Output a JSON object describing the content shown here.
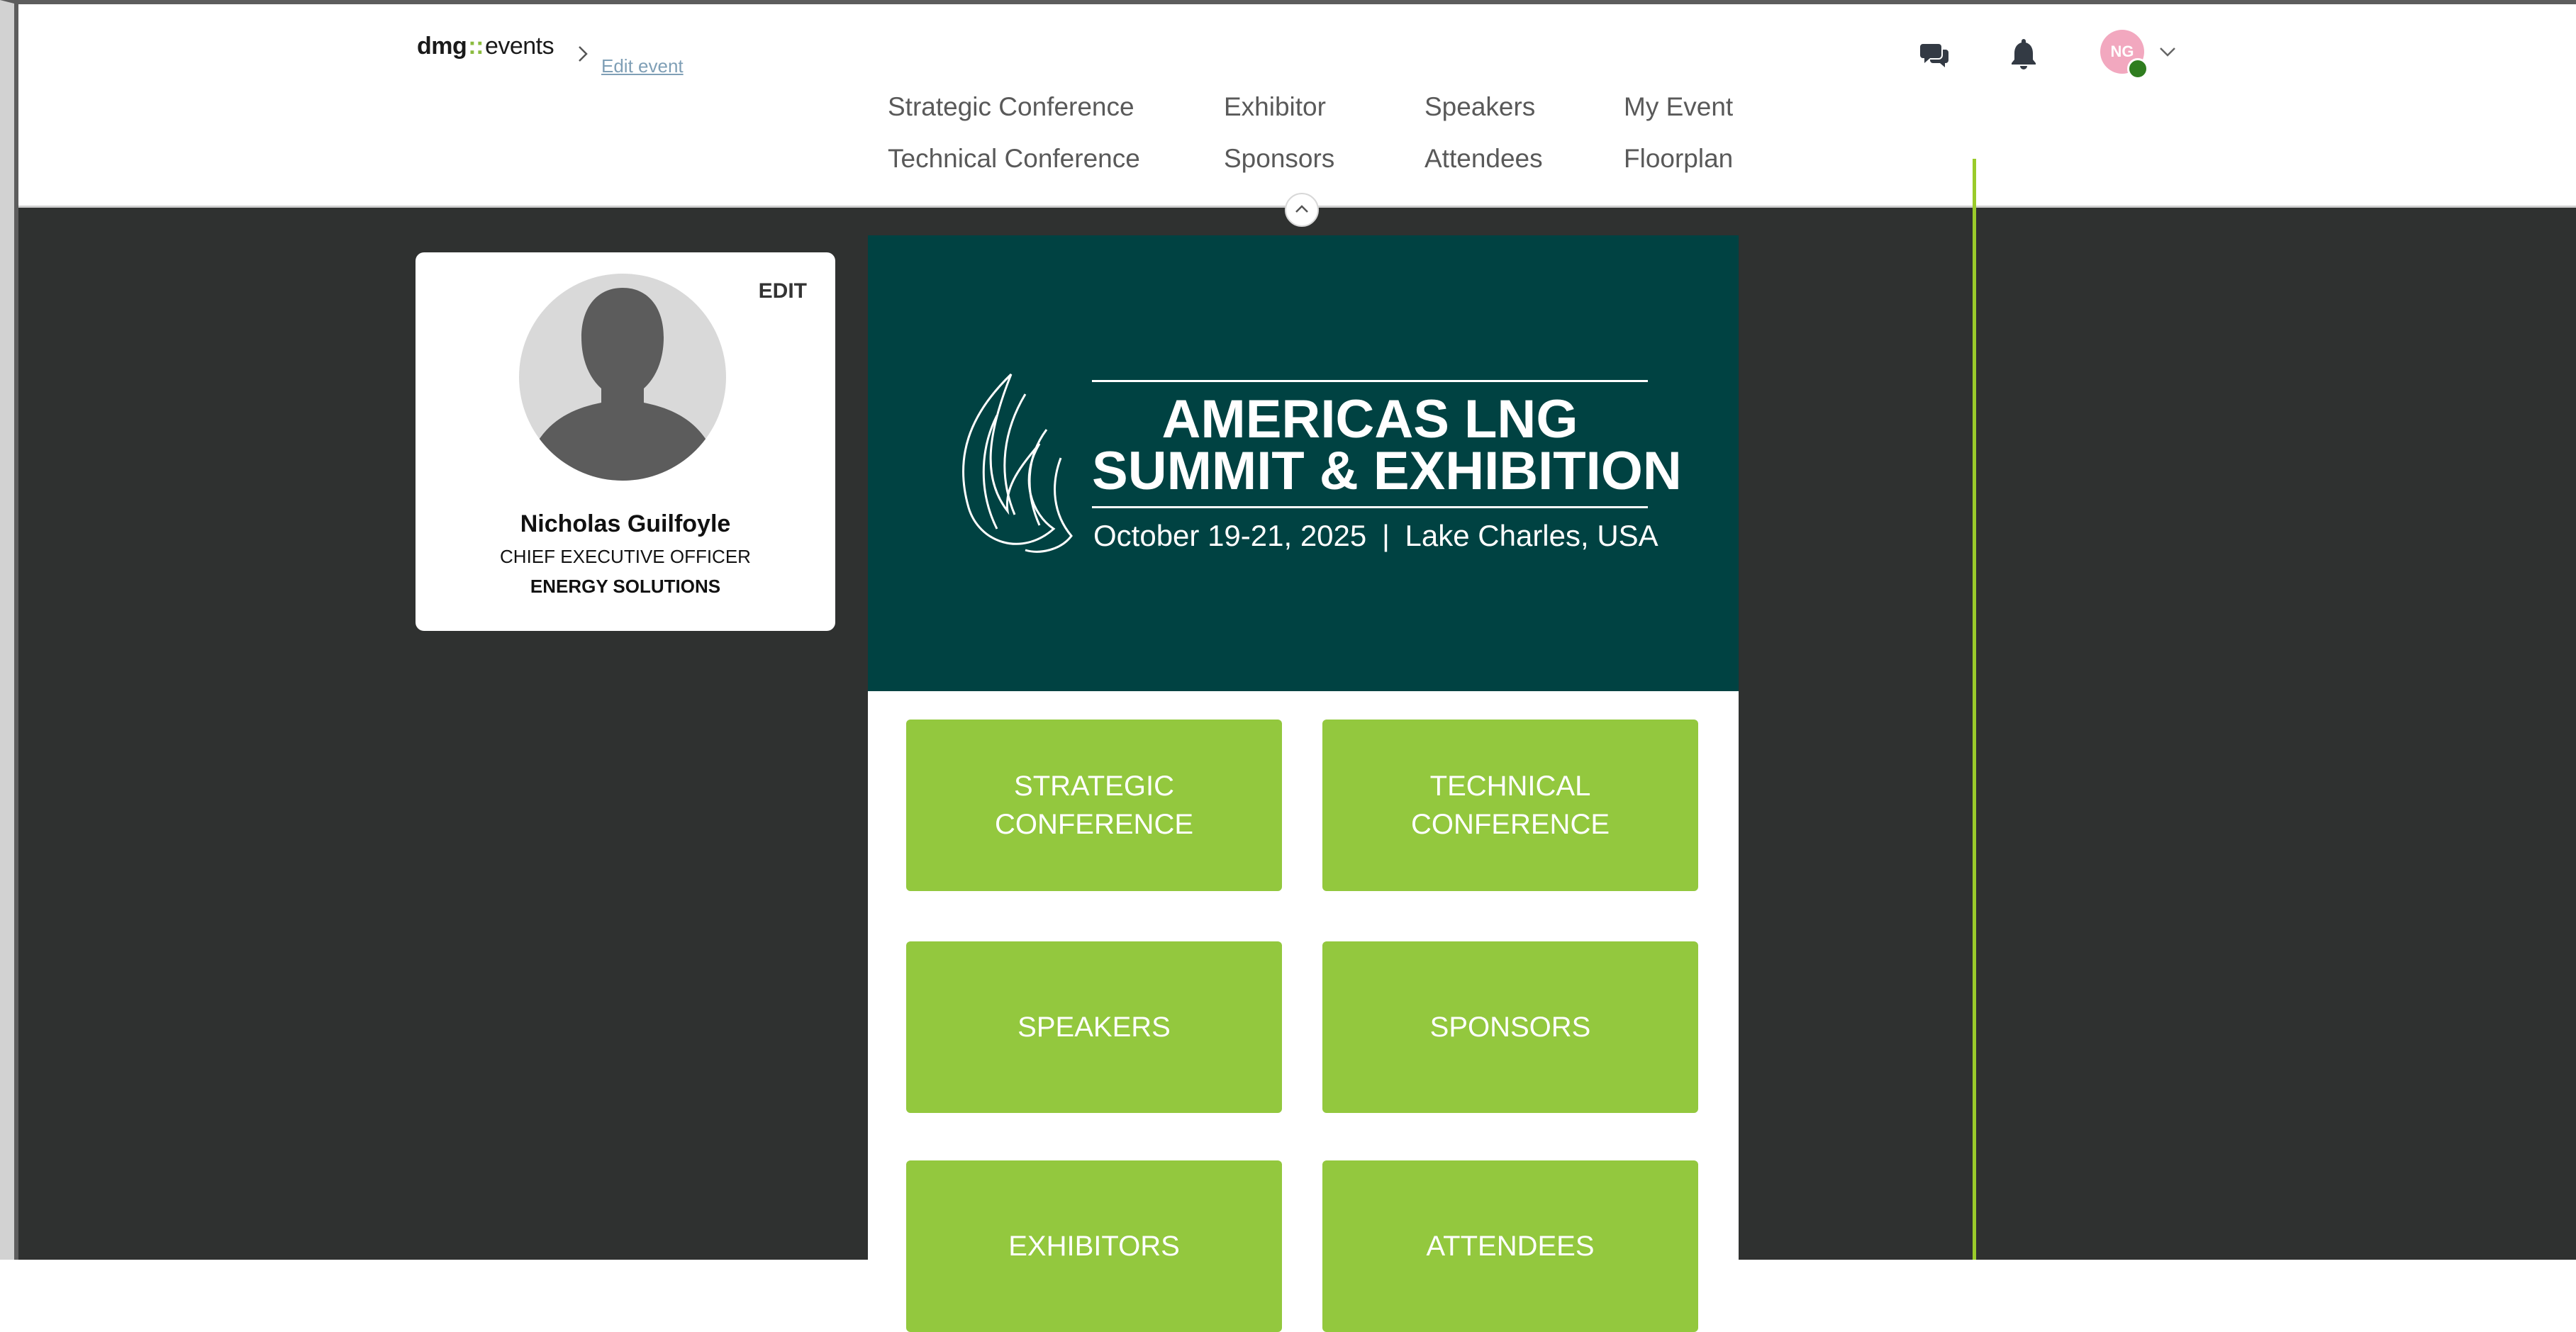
{
  "header": {
    "logo": {
      "brand": "dmg",
      "separator": "::",
      "product": "events"
    },
    "breadcrumb": {
      "edit_event_label": "Edit event"
    },
    "nav": [
      {
        "label": "Strategic Conference"
      },
      {
        "label": "Exhibitor"
      },
      {
        "label": "Speakers"
      },
      {
        "label": "My Event"
      },
      {
        "label": "Technical Conference"
      },
      {
        "label": "Sponsors"
      },
      {
        "label": "Attendees"
      },
      {
        "label": "Floorplan"
      }
    ],
    "user_menu": {
      "initials": "NG",
      "status_color": "#2f7d1f",
      "avatar_color": "#f2a8bf"
    },
    "icons": [
      "chat-icon",
      "bell-icon",
      "chevron-down-icon"
    ]
  },
  "profile": {
    "edit_label": "EDIT",
    "name": "Nicholas Guilfoyle",
    "title": "CHIEF EXECUTIVE OFFICER",
    "company": "ENERGY SOLUTIONS"
  },
  "event": {
    "title_line1": "AMERICAS LNG",
    "title_line2": "SUMMIT & EXHIBITION",
    "date": "October 19-21, 2025",
    "divider": "|",
    "location": "Lake Charles, USA",
    "banner_color": "#004242",
    "tiles": [
      {
        "label": "STRATEGIC CONFERENCE"
      },
      {
        "label": "TECHNICAL CONFERENCE"
      },
      {
        "label": "SPEAKERS"
      },
      {
        "label": "SPONSORS"
      },
      {
        "label": "EXHIBITORS"
      },
      {
        "label": "ATTENDEES"
      }
    ],
    "tile_color": "#93c83e"
  },
  "colors": {
    "accent_green": "#93c83e",
    "page_dark": "#2f3130",
    "divider_line": "#9acb2a"
  }
}
